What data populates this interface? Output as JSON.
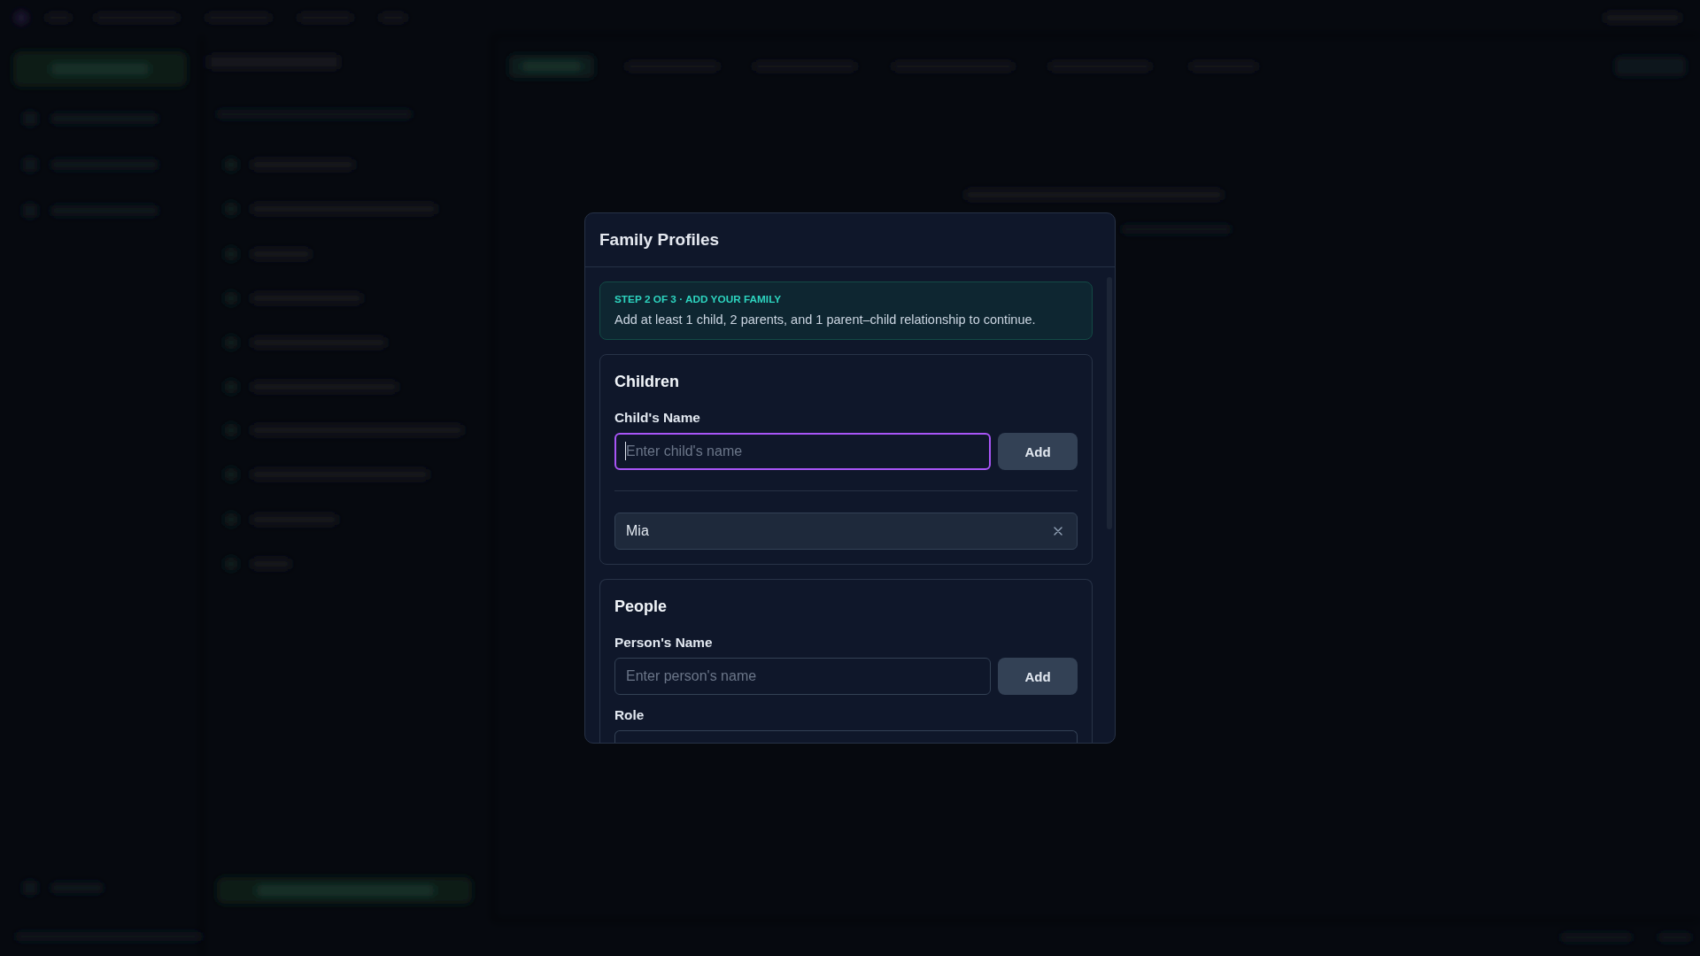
{
  "dialog": {
    "title": "Family Profiles",
    "step_banner": {
      "step": "STEP 2 OF 3 · ADD YOUR FAMILY",
      "message": "Add at least 1 child, 2 parents, and 1 parent–child relationship to continue."
    },
    "sections": [
      {
        "title": "Children",
        "fields": [
          {
            "kind": "text_add",
            "label": "Child's Name",
            "placeholder": "Enter child's name",
            "focused": true,
            "button": "Add"
          }
        ],
        "items": [
          {
            "name": "Mia"
          }
        ]
      },
      {
        "title": "People",
        "fields": [
          {
            "kind": "text_add",
            "label": "Person's Name",
            "placeholder": "Enter person's name",
            "focused": false,
            "button": "Add"
          },
          {
            "kind": "select",
            "label": "Role"
          }
        ]
      }
    ]
  }
}
